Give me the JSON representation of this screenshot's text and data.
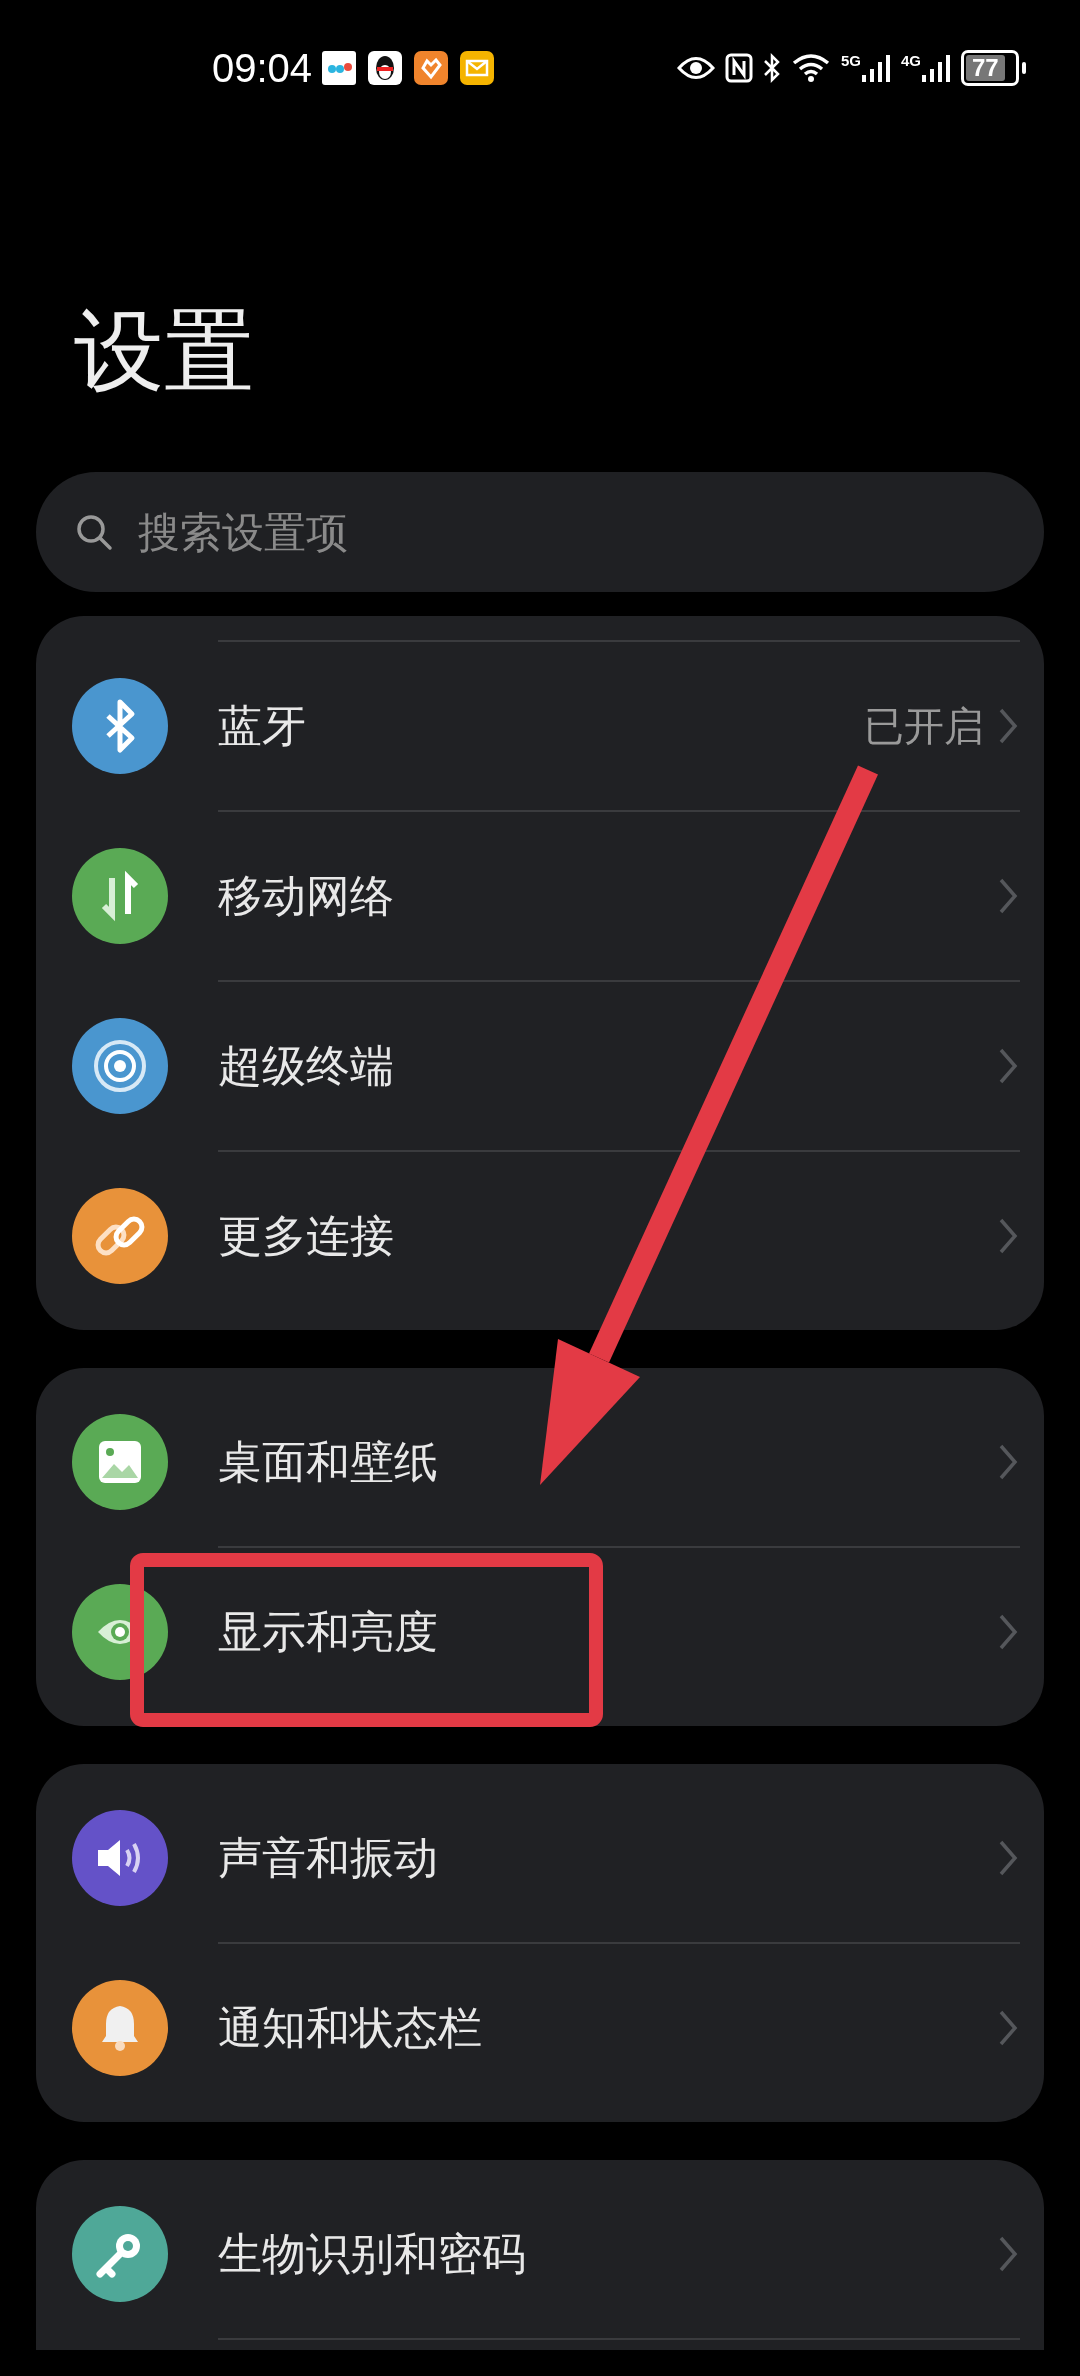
{
  "status_bar": {
    "time": "09:04",
    "network_labels": [
      "5G",
      "4G"
    ],
    "battery": "77"
  },
  "title": "设置",
  "search": {
    "placeholder": "搜索设置项"
  },
  "groups": [
    {
      "items": [
        {
          "kind": "bluetooth",
          "color": "#4a96cf",
          "label": "蓝牙",
          "value": "已开启"
        },
        {
          "kind": "mobile-data",
          "color": "#5aaa55",
          "label": "移动网络"
        },
        {
          "kind": "super-device",
          "color": "#4a96cf",
          "label": "超级终端"
        },
        {
          "kind": "link",
          "color": "#e8923a",
          "label": "更多连接"
        }
      ]
    },
    {
      "items": [
        {
          "kind": "wallpaper",
          "color": "#5aaa55",
          "label": "桌面和壁纸"
        },
        {
          "kind": "eye",
          "color": "#5aaa55",
          "label": "显示和亮度"
        }
      ]
    },
    {
      "items": [
        {
          "kind": "sound",
          "color": "#6452c8",
          "label": "声音和振动"
        },
        {
          "kind": "bell",
          "color": "#e8923a",
          "label": "通知和状态栏"
        }
      ]
    },
    {
      "items": [
        {
          "kind": "key",
          "color": "#4fa898",
          "label": "生物识别和密码"
        }
      ]
    }
  ]
}
